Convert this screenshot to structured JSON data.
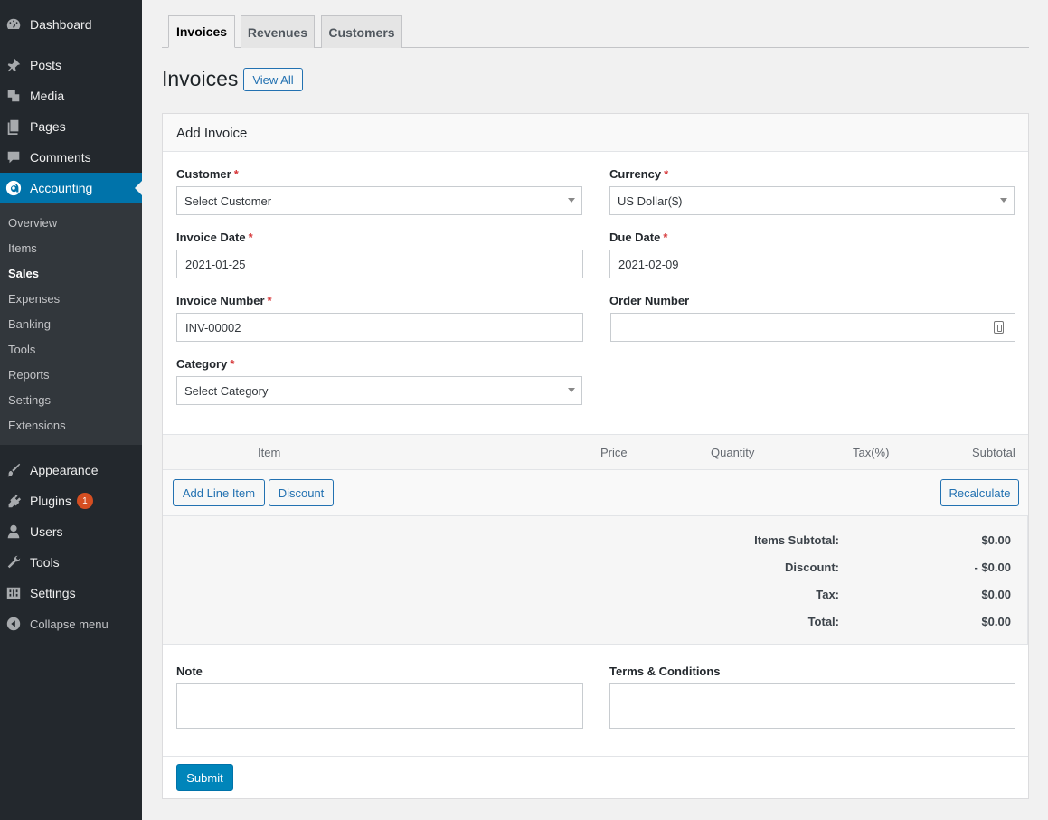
{
  "sidebar": {
    "top": [
      {
        "label": "Dashboard",
        "icon": "dashboard-icon"
      }
    ],
    "items": [
      {
        "label": "Posts",
        "icon": "pin-icon"
      },
      {
        "label": "Media",
        "icon": "media-icon"
      },
      {
        "label": "Pages",
        "icon": "pages-icon"
      },
      {
        "label": "Comments",
        "icon": "comment-icon"
      },
      {
        "label": "Accounting",
        "icon": "accounting-icon"
      }
    ],
    "submenu": [
      "Overview",
      "Items",
      "Sales",
      "Expenses",
      "Banking",
      "Tools",
      "Reports",
      "Settings",
      "Extensions"
    ],
    "lower": [
      {
        "label": "Appearance",
        "icon": "brush-icon"
      },
      {
        "label": "Plugins",
        "icon": "plugin-icon",
        "badge": "1"
      },
      {
        "label": "Users",
        "icon": "user-icon"
      },
      {
        "label": "Tools",
        "icon": "wrench-icon"
      },
      {
        "label": "Settings",
        "icon": "settings-icon"
      }
    ],
    "collapse": "Collapse menu",
    "accent": "#0073aa"
  },
  "tabs": [
    "Invoices",
    "Revenues",
    "Customers"
  ],
  "page": {
    "title": "Invoices",
    "view_all": "View All"
  },
  "form": {
    "heading": "Add Invoice",
    "customer": {
      "label": "Customer",
      "value": "Select Customer"
    },
    "currency": {
      "label": "Currency",
      "value": "US Dollar($)"
    },
    "invoice_date": {
      "label": "Invoice Date",
      "value": "2021-01-25"
    },
    "due_date": {
      "label": "Due Date",
      "value": "2021-02-09"
    },
    "invoice_number": {
      "label": "Invoice Number",
      "value": "INV-00002"
    },
    "order_number": {
      "label": "Order Number",
      "value": ""
    },
    "category": {
      "label": "Category",
      "value": "Select Category"
    },
    "required_mark": "*"
  },
  "items": {
    "columns": [
      "Item",
      "Price",
      "Quantity",
      "Tax(%)",
      "Subtotal"
    ],
    "add_line": "Add Line Item",
    "discount": "Discount",
    "recalculate": "Recalculate"
  },
  "totals": [
    {
      "label": "Items Subtotal:",
      "value": "$0.00"
    },
    {
      "label": "Discount:",
      "value": "- $0.00"
    },
    {
      "label": "Tax:",
      "value": "$0.00"
    },
    {
      "label": "Total:",
      "value": "$0.00"
    }
  ],
  "note_label": "Note",
  "terms_label": "Terms & Conditions",
  "submit": "Submit"
}
